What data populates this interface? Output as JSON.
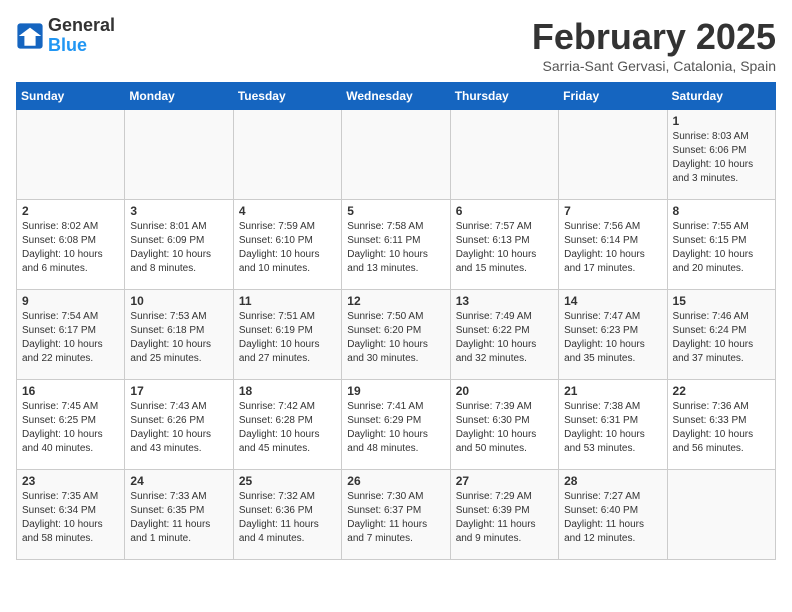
{
  "header": {
    "logo_line1": "General",
    "logo_line2": "Blue",
    "month_year": "February 2025",
    "subtitle": "Sarria-Sant Gervasi, Catalonia, Spain"
  },
  "days_of_week": [
    "Sunday",
    "Monday",
    "Tuesday",
    "Wednesday",
    "Thursday",
    "Friday",
    "Saturday"
  ],
  "weeks": [
    [
      {
        "day": "",
        "info": ""
      },
      {
        "day": "",
        "info": ""
      },
      {
        "day": "",
        "info": ""
      },
      {
        "day": "",
        "info": ""
      },
      {
        "day": "",
        "info": ""
      },
      {
        "day": "",
        "info": ""
      },
      {
        "day": "1",
        "info": "Sunrise: 8:03 AM\nSunset: 6:06 PM\nDaylight: 10 hours and 3 minutes."
      }
    ],
    [
      {
        "day": "2",
        "info": "Sunrise: 8:02 AM\nSunset: 6:08 PM\nDaylight: 10 hours and 6 minutes."
      },
      {
        "day": "3",
        "info": "Sunrise: 8:01 AM\nSunset: 6:09 PM\nDaylight: 10 hours and 8 minutes."
      },
      {
        "day": "4",
        "info": "Sunrise: 7:59 AM\nSunset: 6:10 PM\nDaylight: 10 hours and 10 minutes."
      },
      {
        "day": "5",
        "info": "Sunrise: 7:58 AM\nSunset: 6:11 PM\nDaylight: 10 hours and 13 minutes."
      },
      {
        "day": "6",
        "info": "Sunrise: 7:57 AM\nSunset: 6:13 PM\nDaylight: 10 hours and 15 minutes."
      },
      {
        "day": "7",
        "info": "Sunrise: 7:56 AM\nSunset: 6:14 PM\nDaylight: 10 hours and 17 minutes."
      },
      {
        "day": "8",
        "info": "Sunrise: 7:55 AM\nSunset: 6:15 PM\nDaylight: 10 hours and 20 minutes."
      }
    ],
    [
      {
        "day": "9",
        "info": "Sunrise: 7:54 AM\nSunset: 6:17 PM\nDaylight: 10 hours and 22 minutes."
      },
      {
        "day": "10",
        "info": "Sunrise: 7:53 AM\nSunset: 6:18 PM\nDaylight: 10 hours and 25 minutes."
      },
      {
        "day": "11",
        "info": "Sunrise: 7:51 AM\nSunset: 6:19 PM\nDaylight: 10 hours and 27 minutes."
      },
      {
        "day": "12",
        "info": "Sunrise: 7:50 AM\nSunset: 6:20 PM\nDaylight: 10 hours and 30 minutes."
      },
      {
        "day": "13",
        "info": "Sunrise: 7:49 AM\nSunset: 6:22 PM\nDaylight: 10 hours and 32 minutes."
      },
      {
        "day": "14",
        "info": "Sunrise: 7:47 AM\nSunset: 6:23 PM\nDaylight: 10 hours and 35 minutes."
      },
      {
        "day": "15",
        "info": "Sunrise: 7:46 AM\nSunset: 6:24 PM\nDaylight: 10 hours and 37 minutes."
      }
    ],
    [
      {
        "day": "16",
        "info": "Sunrise: 7:45 AM\nSunset: 6:25 PM\nDaylight: 10 hours and 40 minutes."
      },
      {
        "day": "17",
        "info": "Sunrise: 7:43 AM\nSunset: 6:26 PM\nDaylight: 10 hours and 43 minutes."
      },
      {
        "day": "18",
        "info": "Sunrise: 7:42 AM\nSunset: 6:28 PM\nDaylight: 10 hours and 45 minutes."
      },
      {
        "day": "19",
        "info": "Sunrise: 7:41 AM\nSunset: 6:29 PM\nDaylight: 10 hours and 48 minutes."
      },
      {
        "day": "20",
        "info": "Sunrise: 7:39 AM\nSunset: 6:30 PM\nDaylight: 10 hours and 50 minutes."
      },
      {
        "day": "21",
        "info": "Sunrise: 7:38 AM\nSunset: 6:31 PM\nDaylight: 10 hours and 53 minutes."
      },
      {
        "day": "22",
        "info": "Sunrise: 7:36 AM\nSunset: 6:33 PM\nDaylight: 10 hours and 56 minutes."
      }
    ],
    [
      {
        "day": "23",
        "info": "Sunrise: 7:35 AM\nSunset: 6:34 PM\nDaylight: 10 hours and 58 minutes."
      },
      {
        "day": "24",
        "info": "Sunrise: 7:33 AM\nSunset: 6:35 PM\nDaylight: 11 hours and 1 minute."
      },
      {
        "day": "25",
        "info": "Sunrise: 7:32 AM\nSunset: 6:36 PM\nDaylight: 11 hours and 4 minutes."
      },
      {
        "day": "26",
        "info": "Sunrise: 7:30 AM\nSunset: 6:37 PM\nDaylight: 11 hours and 7 minutes."
      },
      {
        "day": "27",
        "info": "Sunrise: 7:29 AM\nSunset: 6:39 PM\nDaylight: 11 hours and 9 minutes."
      },
      {
        "day": "28",
        "info": "Sunrise: 7:27 AM\nSunset: 6:40 PM\nDaylight: 11 hours and 12 minutes."
      },
      {
        "day": "",
        "info": ""
      }
    ]
  ]
}
